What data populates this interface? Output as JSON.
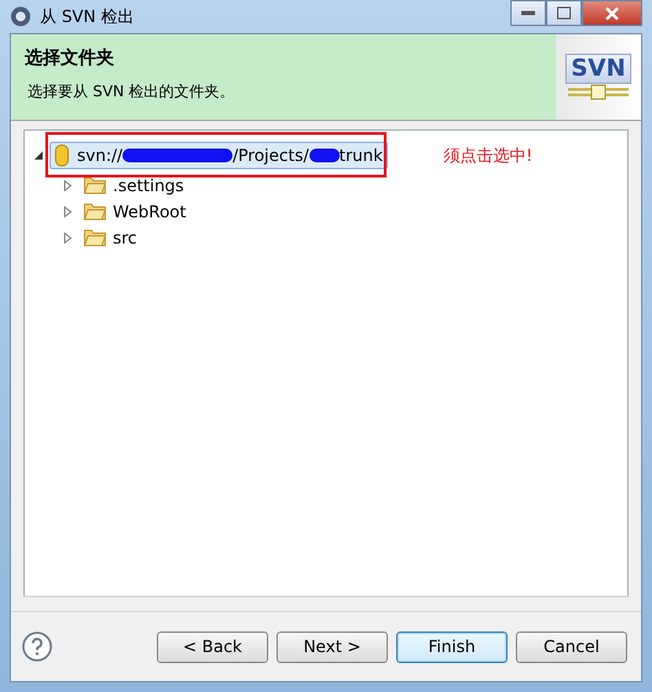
{
  "window": {
    "title": "从 SVN 检出"
  },
  "header": {
    "title": "选择文件夹",
    "description": "选择要从 SVN 检出的文件夹。",
    "logo": "SVN"
  },
  "tree": {
    "items": [
      {
        "kind": "repository",
        "expanded": true,
        "selected": true,
        "segments": [
          {
            "kind": "text",
            "text": "svn://"
          },
          {
            "kind": "redacted"
          },
          {
            "kind": "text",
            "text": "/Projects/"
          },
          {
            "kind": "redacted"
          },
          {
            "kind": "text",
            "text": "trunk"
          }
        ],
        "children": [
          {
            "kind": "folder",
            "label": ".settings",
            "expanded": false,
            "selected": false
          },
          {
            "kind": "folder",
            "label": "WebRoot",
            "expanded": false,
            "selected": false
          },
          {
            "kind": "folder",
            "label": "src",
            "expanded": false,
            "selected": false
          }
        ]
      }
    ]
  },
  "annotation": {
    "text": "须点击选中!"
  },
  "buttons": [
    {
      "label": "< Back",
      "default": false
    },
    {
      "label": "Next >",
      "default": false
    },
    {
      "label": "Finish",
      "default": true
    },
    {
      "label": "Cancel",
      "default": false
    }
  ]
}
